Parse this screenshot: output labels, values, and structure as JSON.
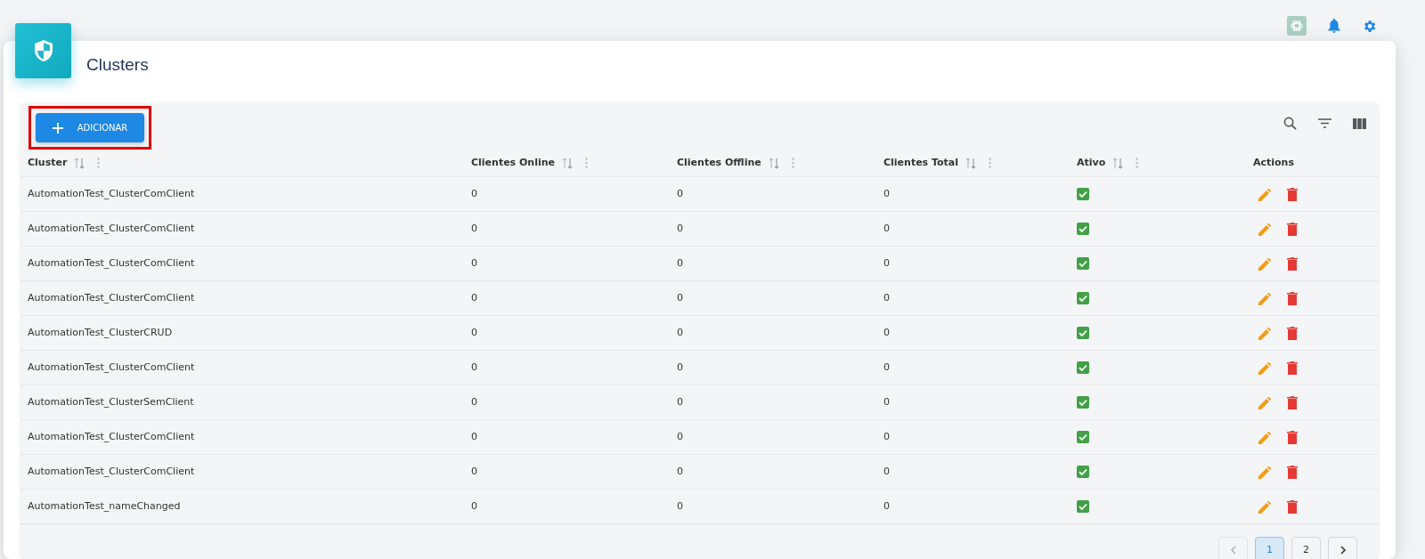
{
  "page": {
    "title": "Clusters"
  },
  "toolbar": {
    "add_button": "ADICIONAR"
  },
  "table": {
    "columns": [
      {
        "label": "Cluster",
        "sortable": true
      },
      {
        "label": "Clientes Online",
        "sortable": true
      },
      {
        "label": "Clientes Offline",
        "sortable": true
      },
      {
        "label": "Clientes Total",
        "sortable": true
      },
      {
        "label": "Ativo",
        "sortable": true
      },
      {
        "label": "Actions",
        "sortable": false
      }
    ],
    "rows": [
      {
        "cluster": "AutomationTest_ClusterComClient",
        "online": "0",
        "offline": "0",
        "total": "0",
        "active": true
      },
      {
        "cluster": "AutomationTest_ClusterComClient",
        "online": "0",
        "offline": "0",
        "total": "0",
        "active": true
      },
      {
        "cluster": "AutomationTest_ClusterComClient",
        "online": "0",
        "offline": "0",
        "total": "0",
        "active": true
      },
      {
        "cluster": "AutomationTest_ClusterComClient",
        "online": "0",
        "offline": "0",
        "total": "0",
        "active": true
      },
      {
        "cluster": "AutomationTest_ClusterCRUD",
        "online": "0",
        "offline": "0",
        "total": "0",
        "active": true
      },
      {
        "cluster": "AutomationTest_ClusterComClient",
        "online": "0",
        "offline": "0",
        "total": "0",
        "active": true
      },
      {
        "cluster": "AutomationTest_ClusterSemClient",
        "online": "0",
        "offline": "0",
        "total": "0",
        "active": true
      },
      {
        "cluster": "AutomationTest_ClusterComClient",
        "online": "0",
        "offline": "0",
        "total": "0",
        "active": true
      },
      {
        "cluster": "AutomationTest_ClusterComClient",
        "online": "0",
        "offline": "0",
        "total": "0",
        "active": true
      },
      {
        "cluster": "AutomationTest_nameChanged",
        "online": "0",
        "offline": "0",
        "total": "0",
        "active": true
      }
    ]
  },
  "pagination": {
    "previous_disabled": true,
    "pages": [
      {
        "label": "1",
        "selected": true
      },
      {
        "label": "2",
        "selected": false
      }
    ]
  }
}
